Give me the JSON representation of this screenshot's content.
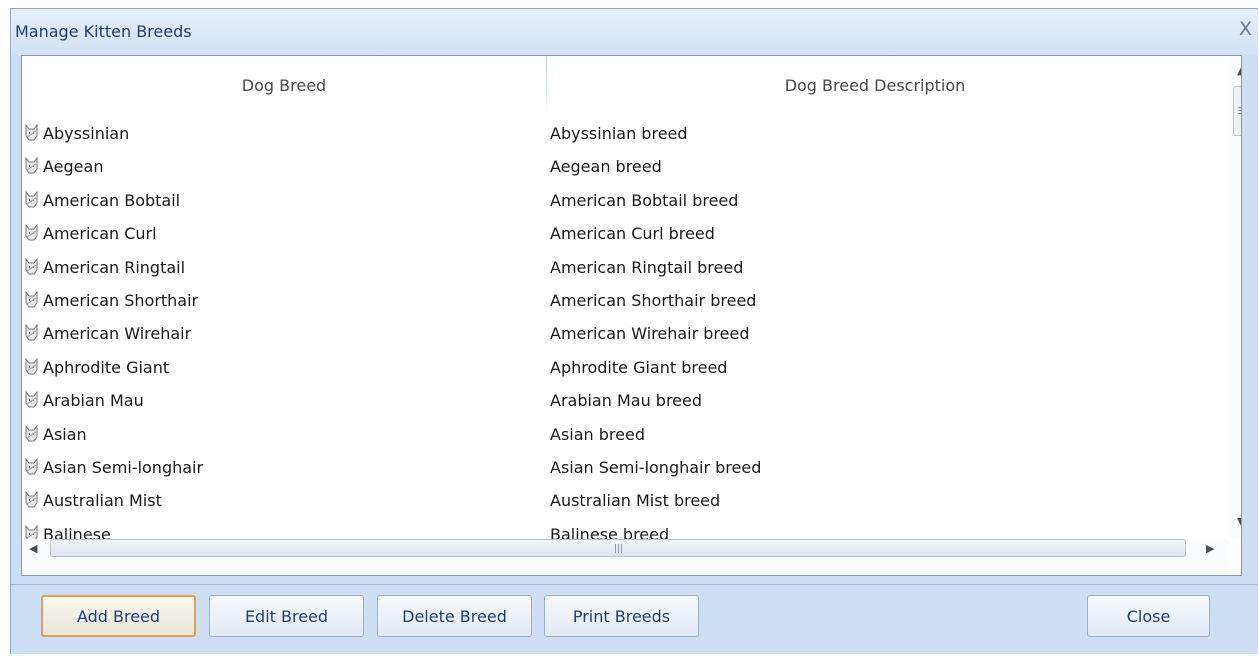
{
  "window": {
    "title": "Manage Kitten Breeds",
    "close_label": "X"
  },
  "grid": {
    "columns": [
      "Dog Breed",
      "Dog Breed Description"
    ],
    "rows": [
      {
        "breed": "Abyssinian",
        "description": "Abyssinian breed"
      },
      {
        "breed": "Aegean",
        "description": "Aegean breed"
      },
      {
        "breed": "American Bobtail",
        "description": "American Bobtail breed"
      },
      {
        "breed": "American Curl",
        "description": "American Curl breed"
      },
      {
        "breed": "American Ringtail",
        "description": "American Ringtail breed"
      },
      {
        "breed": "American Shorthair",
        "description": "American Shorthair breed"
      },
      {
        "breed": "American Wirehair",
        "description": "American Wirehair breed"
      },
      {
        "breed": "Aphrodite Giant",
        "description": "Aphrodite Giant breed"
      },
      {
        "breed": "Arabian Mau",
        "description": "Arabian Mau breed"
      },
      {
        "breed": "Asian",
        "description": "Asian breed"
      },
      {
        "breed": "Asian Semi-longhair",
        "description": "Asian Semi-longhair breed"
      },
      {
        "breed": "Australian Mist",
        "description": "Australian Mist breed"
      },
      {
        "breed": "Balinese",
        "description": "Balinese breed"
      }
    ],
    "row_icon": "cat-icon"
  },
  "buttons": {
    "add": "Add Breed",
    "edit": "Edit Breed",
    "delete": "Delete Breed",
    "print": "Print Breeds",
    "close": "Close"
  },
  "colors": {
    "accent": "#1d3f78",
    "window_bg": "#cedff5",
    "default_button_border": "#e0a055"
  }
}
